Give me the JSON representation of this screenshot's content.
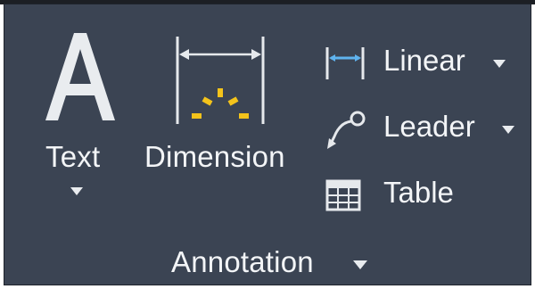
{
  "tools": {
    "text_label": "Text",
    "dimension_label": "Dimension",
    "linear_label": "Linear",
    "leader_label": "Leader",
    "table_label": "Table"
  },
  "panel": {
    "title": "Annotation"
  },
  "icons": {
    "text": "text-icon",
    "dimension": "dimension-icon",
    "linear": "linear-dimension-icon",
    "leader": "leader-icon",
    "table": "table-icon",
    "dropdown": "caret-down-icon"
  },
  "colors": {
    "panel_bg": "#3b4453",
    "text": "#f3f5f7",
    "accent_yellow": "#f3c31b",
    "accent_blue": "#5fb3ee"
  }
}
